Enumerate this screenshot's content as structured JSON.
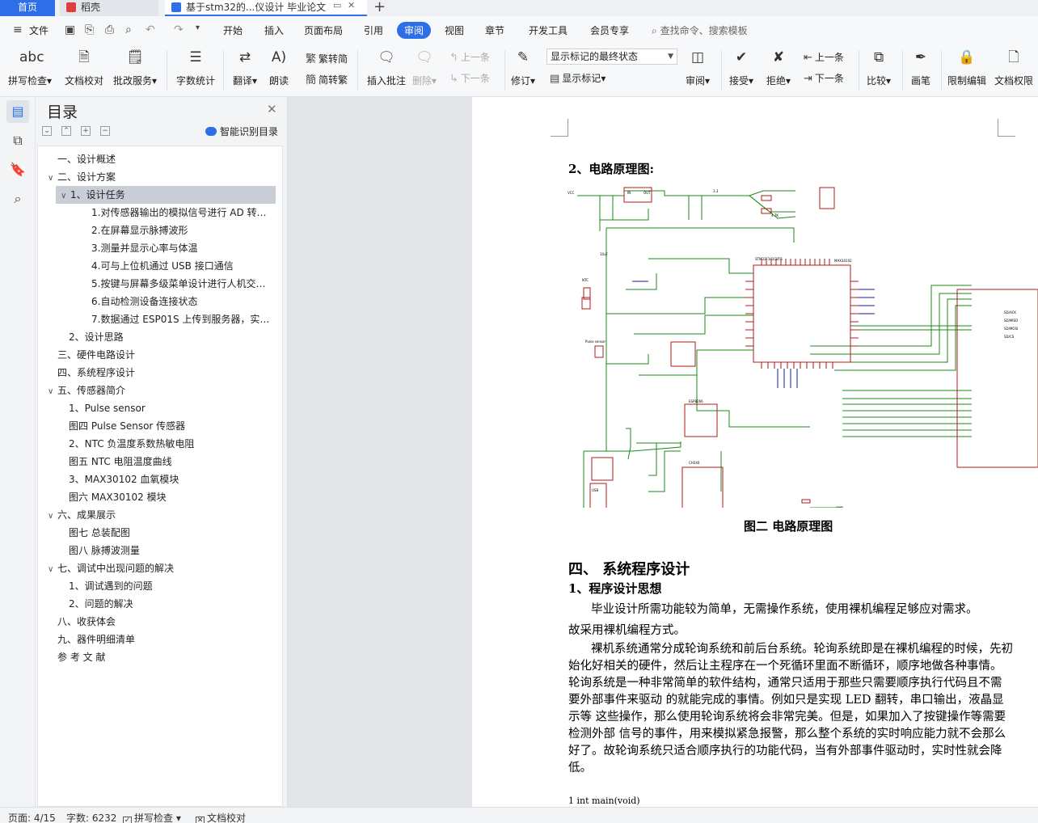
{
  "tabs": {
    "home": "首页",
    "wps": "稻壳",
    "doc": "基于stm32的...仪设计 毕业论文",
    "add": "+"
  },
  "menu": {
    "file": "文件",
    "items": [
      "开始",
      "插入",
      "页面布局",
      "引用",
      "审阅",
      "视图",
      "章节",
      "开发工具",
      "会员专享"
    ],
    "active": "审阅",
    "search": "查找命令、搜索模板"
  },
  "ribbon": {
    "spellcheck": "拼写检查",
    "doc_proof": "文档校对",
    "batch_service": "批改服务",
    "word_count": "字数统计",
    "translate": "翻译",
    "read_aloud": "朗读",
    "to_traditional": "繁转简",
    "to_simplified": "简转繁",
    "insert_comment": "插入批注",
    "delete": "删除",
    "prev_comment": "上一条",
    "next_comment": "下一条",
    "track_changes": "修订",
    "markup_mode": "显示标记的最终状态",
    "show_markup": "显示标记",
    "review": "审阅",
    "accept": "接受",
    "reject": "拒绝",
    "prev_change": "上一条",
    "next_change": "下一条",
    "compare": "比较",
    "pen": "画笔",
    "restrict_edit": "限制编辑",
    "doc_rights": "文档权限"
  },
  "toc": {
    "title": "目录",
    "ai_label": "智能识别目录",
    "items": [
      {
        "text": "一、设计概述",
        "level": 0,
        "arrow": ""
      },
      {
        "text": "二、设计方案",
        "level": 0,
        "arrow": "v"
      },
      {
        "text": "1、设计任务",
        "level": 1,
        "arrow": "v",
        "selected": true
      },
      {
        "text": "1.对传感器输出的模拟信号进行 AD 转…",
        "level": 2,
        "arrow": ""
      },
      {
        "text": "2.在屏幕显示脉搏波形",
        "level": 2,
        "arrow": ""
      },
      {
        "text": "3.测量并显示心率与体温",
        "level": 2,
        "arrow": ""
      },
      {
        "text": "4.可与上位机通过 USB 接口通信",
        "level": 2,
        "arrow": ""
      },
      {
        "text": "5.按键与屏幕多级菜单设计进行人机交…",
        "level": 2,
        "arrow": ""
      },
      {
        "text": "6.自动检测设备连接状态",
        "level": 2,
        "arrow": ""
      },
      {
        "text": "7.数据通过 ESP01S 上传到服务器，实…",
        "level": 2,
        "arrow": ""
      },
      {
        "text": "2、设计思路",
        "level": 1,
        "arrow": ""
      },
      {
        "text": "三、硬件电路设计",
        "level": 0,
        "arrow": ""
      },
      {
        "text": "四、系统程序设计",
        "level": 0,
        "arrow": ""
      },
      {
        "text": "五、传感器简介",
        "level": 0,
        "arrow": "v"
      },
      {
        "text": "1、Pulse sensor",
        "level": 1,
        "arrow": ""
      },
      {
        "text": "图四  Pulse Sensor 传感器",
        "level": 1,
        "arrow": ""
      },
      {
        "text": "2、NTC 负温度系数热敏电阻",
        "level": 1,
        "arrow": ""
      },
      {
        "text": "图五  NTC 电阻温度曲线",
        "level": 1,
        "arrow": ""
      },
      {
        "text": "3、MAX30102 血氧模块",
        "level": 1,
        "arrow": ""
      },
      {
        "text": "图六  MAX30102 模块",
        "level": 1,
        "arrow": ""
      },
      {
        "text": "六、成果展示",
        "level": 0,
        "arrow": "v"
      },
      {
        "text": "图七 总装配图",
        "level": 1,
        "arrow": ""
      },
      {
        "text": "图八 脉搏波测量",
        "level": 1,
        "arrow": ""
      },
      {
        "text": "七、调试中出现问题的解决",
        "level": 0,
        "arrow": "v"
      },
      {
        "text": "1、调试遇到的问题",
        "level": 1,
        "arrow": ""
      },
      {
        "text": "2、问题的解决",
        "level": 1,
        "arrow": ""
      },
      {
        "text": "八、收获体会",
        "level": 0,
        "arrow": ""
      },
      {
        "text": "九、器件明细清单",
        "level": 0,
        "arrow": ""
      },
      {
        "text": "参 考 文 献",
        "level": 0,
        "arrow": ""
      }
    ]
  },
  "document": {
    "section_circuit": "2、电路原理图:",
    "figure_caption": "图二  电路原理图",
    "chapter4": "四、   系统程序设计",
    "section_program": "1、程序设计思想",
    "para1_line1": "毕业设计所需功能较为简单，无需操作系统，使用裸机编程足够应对需求。",
    "para1_line2": "故采用裸机编程方式。",
    "para2": "裸机系统通常分成轮询系统和前后台系统。轮询系统即是在裸机编程的时候，先初始化好相关的硬件，然后让主程序在一个死循环里面不断循环，顺序地做各种事情。轮询系统是一种非常简单的软件结构，通常只适用于那些只需要顺序执行代码且不需要外部事件来驱动 的就能完成的事情。例如只是实现 LED 翻转，串口输出，液晶显示等 这些操作，那么使用轮询系统将会非常完美。但是，如果加入了按键操作等需要检测外部 信号的事件，用来模拟紧急报警，那么整个系统的实时响应能力就不会那么好了。故轮询系统只适合顺序执行的功能代码，当有外部事件驱动时，实时性就会降低。",
    "code_line": "1 int main(void)"
  },
  "status": {
    "page": "页面: 4/15",
    "words": "字数: 6232",
    "spellcheck": "拼写检查",
    "doc_proof": "文档校对"
  },
  "colors": {
    "accent": "#2e6fe8",
    "schematic_wire": "#1a8a1a",
    "schematic_part": "#b01818",
    "schematic_net": "#1a1aa0"
  }
}
